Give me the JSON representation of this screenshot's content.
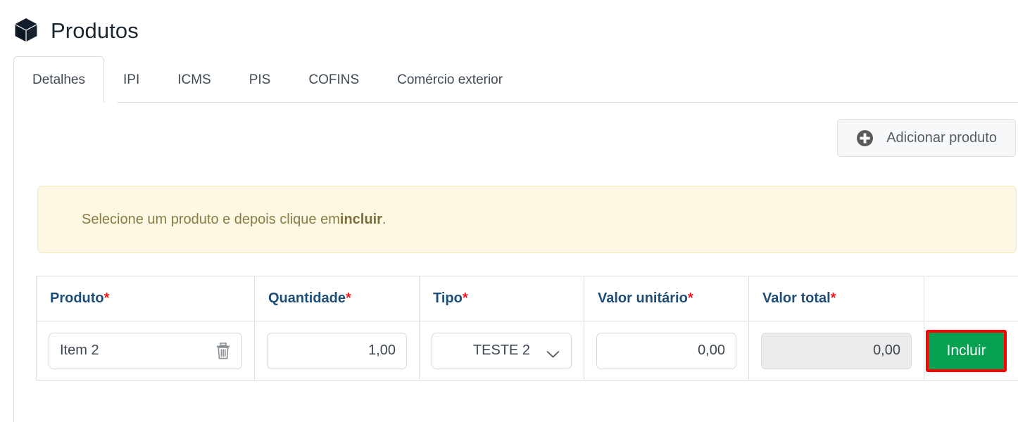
{
  "header": {
    "title": "Produtos",
    "icon": "cube-icon"
  },
  "tabs": [
    {
      "label": "Detalhes",
      "active": true
    },
    {
      "label": "IPI",
      "active": false
    },
    {
      "label": "ICMS",
      "active": false
    },
    {
      "label": "PIS",
      "active": false
    },
    {
      "label": "COFINS",
      "active": false
    },
    {
      "label": "Comércio exterior",
      "active": false
    }
  ],
  "toolbar": {
    "add_product_label": "Adicionar produto",
    "add_product_icon": "plus-circle-icon"
  },
  "alert": {
    "text_before": "Selecione um produto e depois clique em ",
    "emphasis": "incluir",
    "text_after": ".",
    "background_color": "#fdf8e4",
    "border_color": "#f5e7b8",
    "text_color": "#8a7c46"
  },
  "table": {
    "headers": [
      {
        "label": "Produto",
        "required": true
      },
      {
        "label": "Quantidade",
        "required": true
      },
      {
        "label": "Tipo",
        "required": true
      },
      {
        "label": "Valor unitário",
        "required": true
      },
      {
        "label": "Valor total",
        "required": true
      },
      {
        "label": "",
        "required": false
      }
    ],
    "header_color": "#1f4e79",
    "required_marker": "*",
    "required_color": "#f01c1c",
    "rows": [
      {
        "produto": "Item 2",
        "produto_delete_icon": "trash-icon",
        "quantidade": "1,00",
        "tipo": "TESTE 2",
        "tipo_icon": "chevron-down-icon",
        "valor_unitario": "0,00",
        "valor_total": "0,00",
        "valor_total_disabled": true,
        "action_label": "Incluir"
      }
    ]
  },
  "colors": {
    "include_button_green": "#05a150",
    "highlight_red": "#ff0000",
    "title_navy": "#1b2733",
    "border_gray": "#dadfe4"
  }
}
